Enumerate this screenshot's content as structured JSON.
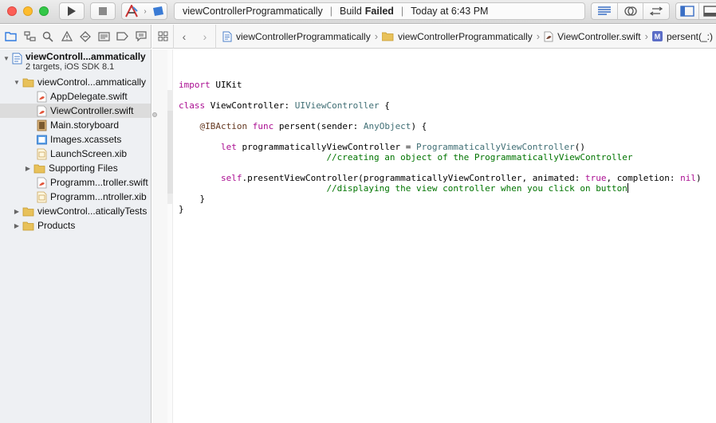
{
  "toolbar": {
    "activity": {
      "scheme": "viewControllerProgrammatically",
      "build_label": "Build",
      "build_status": "Failed",
      "timestamp": "Today at 6:43 PM"
    },
    "icons": [
      "play-icon",
      "stop-icon",
      "xcode-scheme-icon",
      "device-icon",
      "standard-editor-icon",
      "assistant-editor-icon",
      "version-editor-icon",
      "navigator-toggle-icon",
      "debug-toggle-icon"
    ]
  },
  "navigator_tabs": [
    "project-navigator-icon",
    "symbol-navigator-icon",
    "find-navigator-icon",
    "issue-navigator-icon",
    "test-navigator-icon",
    "debug-navigator-icon",
    "breakpoint-navigator-icon",
    "report-navigator-icon"
  ],
  "sidebar": {
    "project": {
      "name": "viewControll...ammatically",
      "subtitle": "2 targets, iOS SDK 8.1"
    },
    "items": [
      {
        "label": "viewControl...ammatically",
        "type": "folder",
        "expanded": true,
        "level": 1
      },
      {
        "label": "AppDelegate.swift",
        "type": "swift",
        "level": 2
      },
      {
        "label": "ViewController.swift",
        "type": "swift",
        "level": 2,
        "selected": true
      },
      {
        "label": "Main.storyboard",
        "type": "storyboard",
        "level": 2
      },
      {
        "label": "Images.xcassets",
        "type": "xcassets",
        "level": 2
      },
      {
        "label": "LaunchScreen.xib",
        "type": "xib",
        "level": 2
      },
      {
        "label": "Supporting Files",
        "type": "folder",
        "expanded": false,
        "level": 2
      },
      {
        "label": "Programm...troller.swift",
        "type": "swift",
        "level": 2
      },
      {
        "label": "Programm...ntroller.xib",
        "type": "xib",
        "level": 2
      },
      {
        "label": "viewControl...aticallyTests",
        "type": "folder",
        "expanded": false,
        "level": 1
      },
      {
        "label": "Products",
        "type": "folder",
        "expanded": false,
        "level": 1
      }
    ]
  },
  "jumpbar": {
    "crumbs": [
      "viewControllerProgrammatically",
      "viewControllerProgrammatically",
      "ViewController.swift",
      "persent(_:)"
    ],
    "method_badge": "M"
  },
  "editor": {
    "lines": [
      [],
      [
        {
          "t": "import",
          "c": "kw"
        },
        {
          "t": " UIKit",
          "c": ""
        }
      ],
      [],
      [
        {
          "t": "class",
          "c": "kw"
        },
        {
          "t": " ViewController: ",
          "c": ""
        },
        {
          "t": "UIViewController",
          "c": "ty"
        },
        {
          "t": " {",
          "c": ""
        }
      ],
      [],
      [
        {
          "t": "    ",
          "c": ""
        },
        {
          "t": "@IBAction",
          "c": "at"
        },
        {
          "t": " ",
          "c": ""
        },
        {
          "t": "func",
          "c": "kw"
        },
        {
          "t": " persent(sender: ",
          "c": ""
        },
        {
          "t": "AnyObject",
          "c": "ty"
        },
        {
          "t": ") {",
          "c": ""
        }
      ],
      [],
      [
        {
          "t": "        ",
          "c": ""
        },
        {
          "t": "let",
          "c": "kw"
        },
        {
          "t": " programmaticallyViewController = ",
          "c": ""
        },
        {
          "t": "ProgrammaticallyViewController",
          "c": "ty"
        },
        {
          "t": "()",
          "c": ""
        }
      ],
      [
        {
          "t": "                            ",
          "c": ""
        },
        {
          "t": "//creating an object of the ProgrammaticallyViewController",
          "c": "cm"
        }
      ],
      [],
      [
        {
          "t": "        ",
          "c": ""
        },
        {
          "t": "self",
          "c": "kw"
        },
        {
          "t": ".presentViewController(programmaticallyViewController, animated: ",
          "c": ""
        },
        {
          "t": "true",
          "c": "kw"
        },
        {
          "t": ", completion: ",
          "c": ""
        },
        {
          "t": "nil",
          "c": "kw"
        },
        {
          "t": ")",
          "c": ""
        }
      ],
      [
        {
          "t": "                            ",
          "c": ""
        },
        {
          "t": "//displaying the view controller when you click on button",
          "c": "cm"
        },
        {
          "t": "",
          "c": "caret"
        }
      ],
      [
        {
          "t": "    }",
          "c": ""
        }
      ],
      [
        {
          "t": "}",
          "c": ""
        }
      ]
    ]
  }
}
